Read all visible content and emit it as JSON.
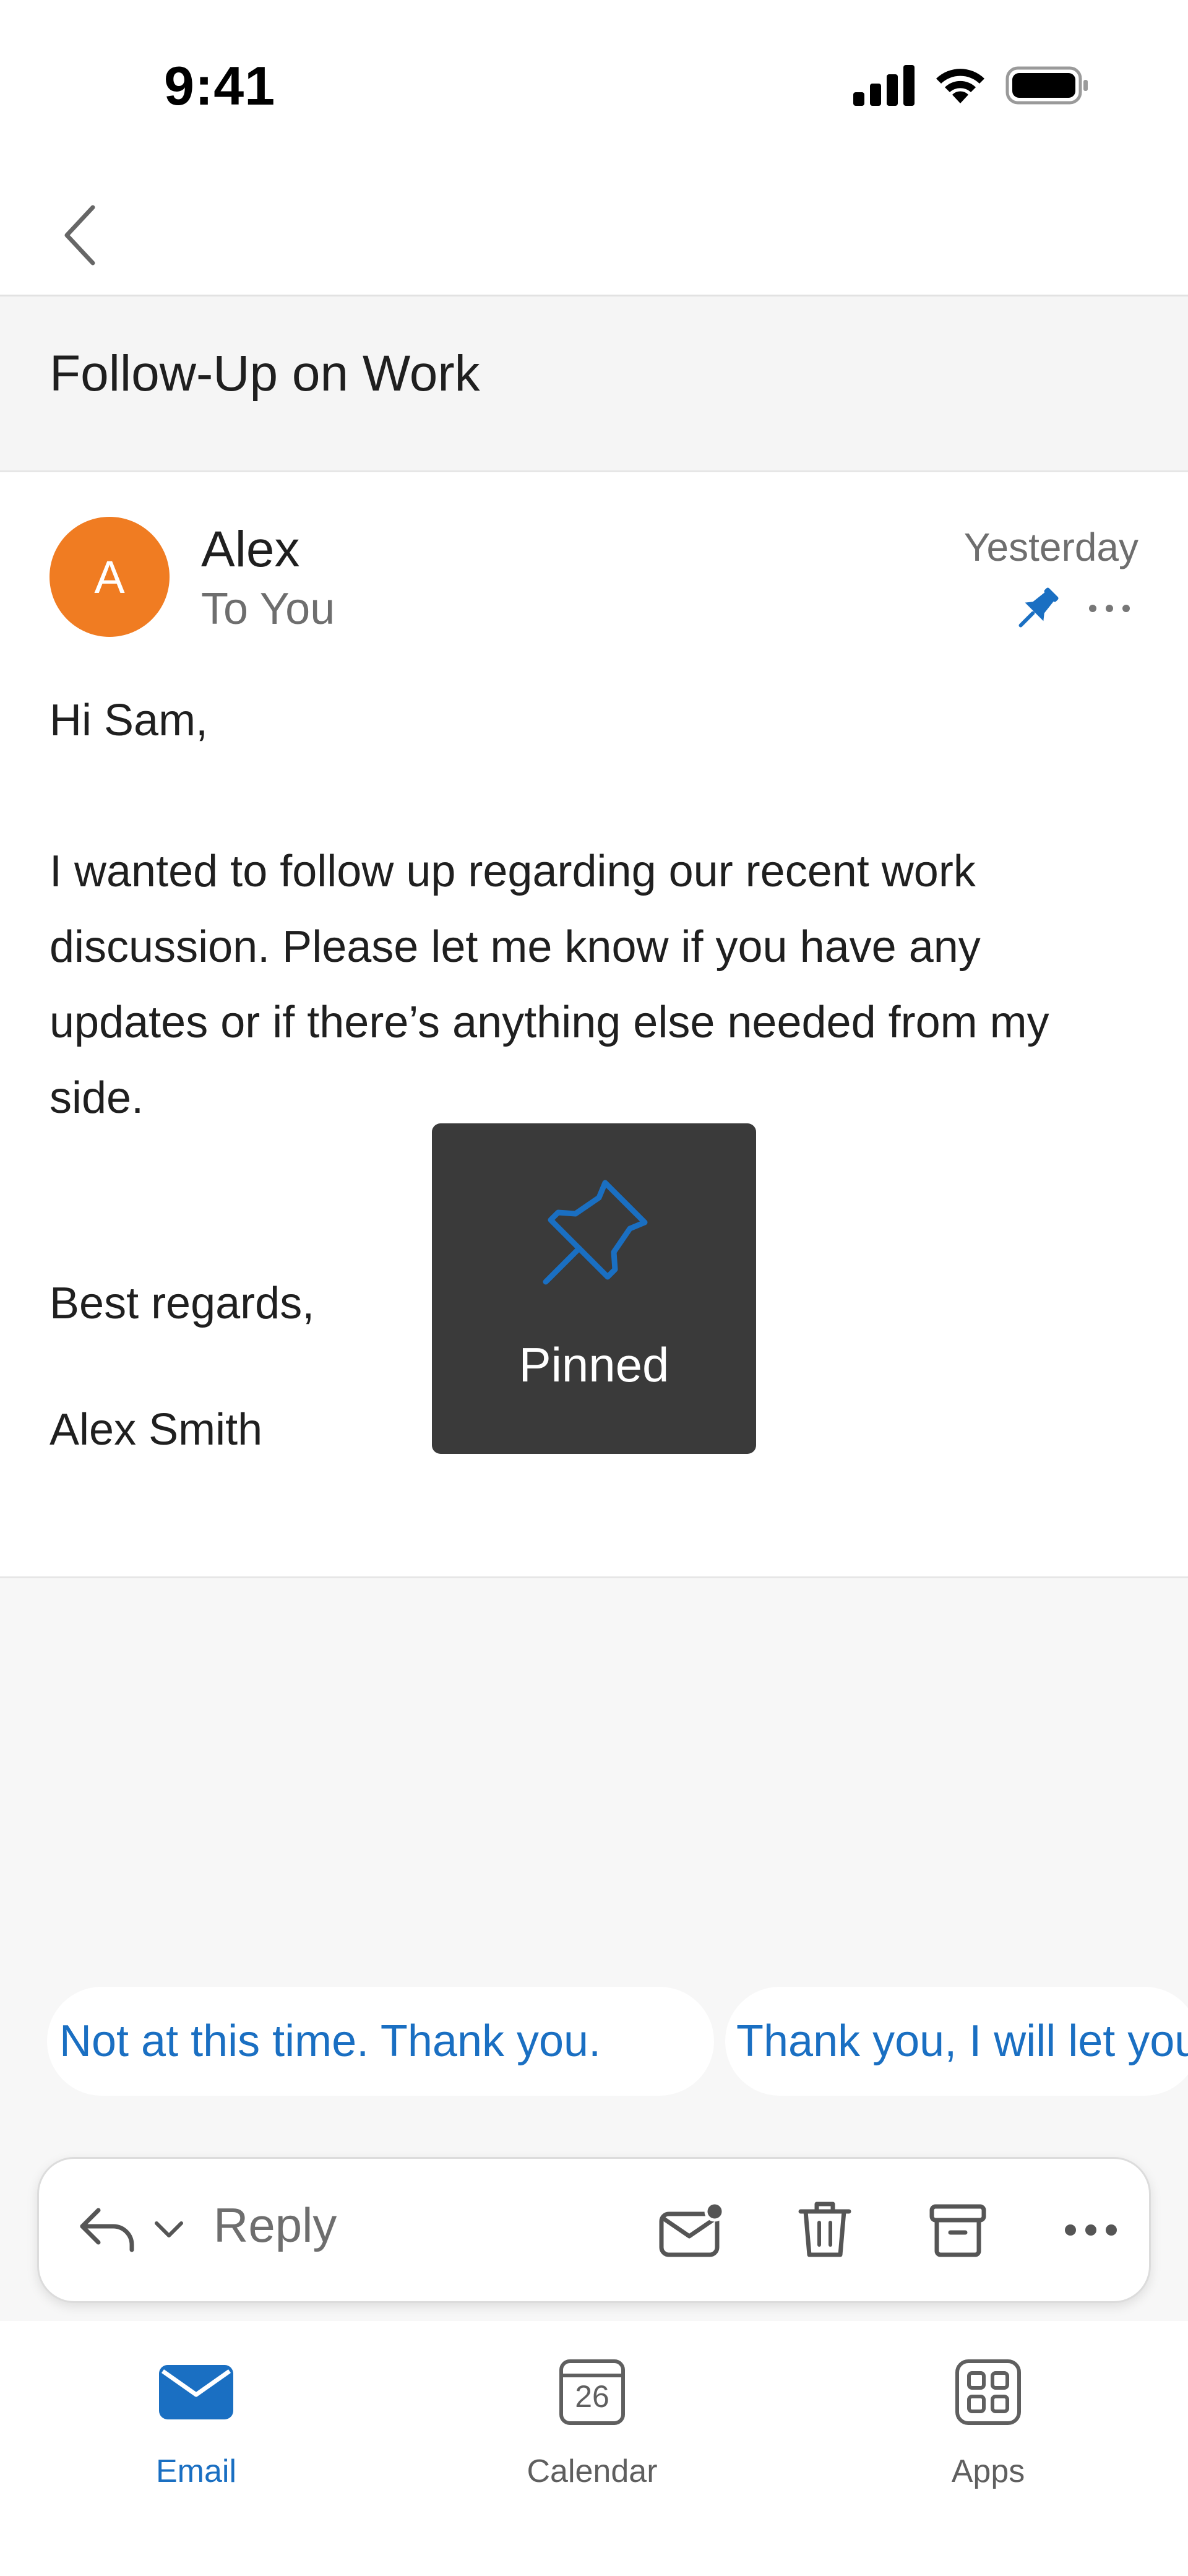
{
  "status_bar": {
    "time": "9:41"
  },
  "nav": {
    "back_icon": "chevron-left-icon"
  },
  "subject": "Follow-Up on Work",
  "message": {
    "avatar_initial": "A",
    "avatar_color": "#f07c22",
    "sender": "Alex",
    "recipient": "To You",
    "date": "Yesterday",
    "greeting": "Hi Sam,",
    "paragraph": "I wanted to follow up regarding our recent work discussion. Please let me know if you have any updates or if there’s anything else needed from my side.",
    "closing": "Best regards,",
    "signature": "Alex Smith"
  },
  "toast": {
    "label": "Pinned",
    "icon": "pin-icon"
  },
  "suggested_replies": [
    "Not at this time. Thank you.",
    "Thank you, I will let you"
  ],
  "reply_toolbar": {
    "reply_label": "Reply"
  },
  "tabs": [
    {
      "label": "Email"
    },
    {
      "label": "Calendar",
      "date_number": "26"
    },
    {
      "label": "Apps"
    }
  ],
  "colors": {
    "accent": "#1a6fc2",
    "toast_bg": "#3a3a3a"
  }
}
